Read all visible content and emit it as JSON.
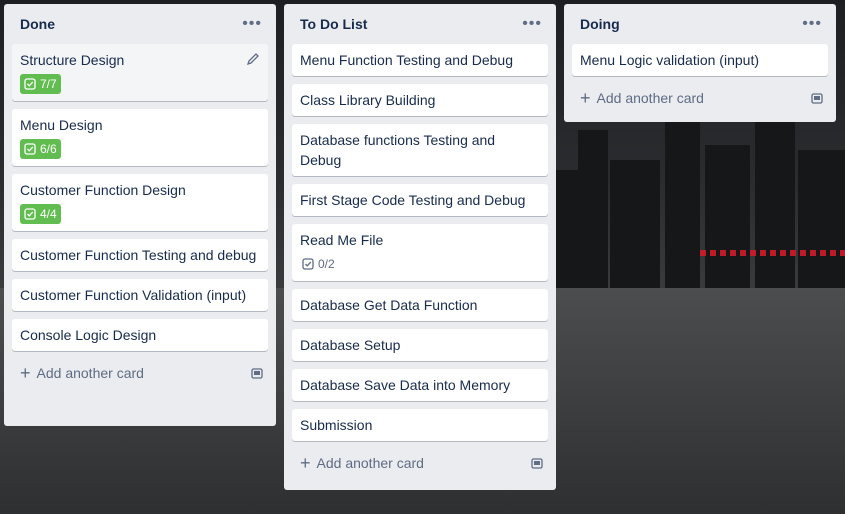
{
  "lists": [
    {
      "title": "Done",
      "cards": [
        {
          "title": "Structure Design",
          "badge": "7/7"
        },
        {
          "title": "Menu Design",
          "badge": "6/6"
        },
        {
          "title": "Customer Function Design",
          "badge": "4/4"
        },
        {
          "title": "Customer Function Testing and debug"
        },
        {
          "title": "Customer Function Validation (input)"
        },
        {
          "title": "Console Logic Design"
        }
      ],
      "add_label": "Add another card"
    },
    {
      "title": "To Do List",
      "cards": [
        {
          "title": "Menu Function Testing and Debug"
        },
        {
          "title": "Class Library Building"
        },
        {
          "title": "Database functions Testing and Debug"
        },
        {
          "title": "First Stage Code Testing and Debug"
        },
        {
          "title": "Read Me File",
          "badge": "0/2"
        },
        {
          "title": "Database Get Data Function"
        },
        {
          "title": "Database Setup"
        },
        {
          "title": "Database Save Data into Memory"
        },
        {
          "title": "Submission"
        }
      ],
      "add_label": "Add another card"
    },
    {
      "title": "Doing",
      "cards": [
        {
          "title": "Menu Logic validation (input)"
        }
      ],
      "add_label": "Add another card"
    }
  ],
  "icons": {
    "more": "ellipsis-icon",
    "edit": "pencil-icon",
    "checklist": "checkbox-icon",
    "add": "plus-icon",
    "template": "card-template-icon"
  },
  "colors": {
    "list_bg": "#ebecf0",
    "card_bg": "#ffffff",
    "badge_complete": "#61bd4f",
    "text": "#172b4d",
    "muted": "#5e6c84"
  }
}
